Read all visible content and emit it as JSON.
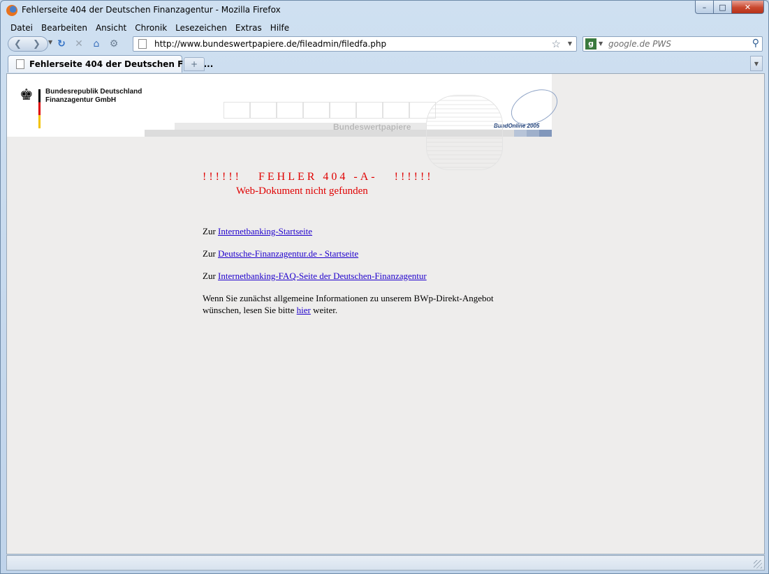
{
  "window": {
    "title": "Fehlerseite 404 der Deutschen Finanzagentur - Mozilla Firefox",
    "controls": {
      "minimize": "–",
      "maximize": "□",
      "close": "✕"
    }
  },
  "menu": [
    "Datei",
    "Bearbeiten",
    "Ansicht",
    "Chronik",
    "Lesezeichen",
    "Extras",
    "Hilfe"
  ],
  "navigation": {
    "url": "http://www.bundeswertpapiere.de/fileadmin/filedfa.php",
    "search_placeholder": "google.de PWS",
    "icons": [
      "back-icon",
      "forward-icon",
      "reload-icon",
      "stop-icon",
      "home-icon",
      "addon-icon",
      "star-icon",
      "search-icon"
    ]
  },
  "tabs": [
    {
      "title": "Fehlerseite 404 der Deutschen Finan...",
      "active": true
    }
  ],
  "page": {
    "org_line1": "Bundesrepublik Deutschland",
    "org_line2": "Finanzagentur GmbH",
    "banner_watermark": "Bundeswertpapiere",
    "bundonline": "BundOnline 2005",
    "error_title": "!!!!!!   FEHLER 404 -A-   !!!!!!",
    "error_subtitle": "Web-Dokument nicht gefunden",
    "prefix": "Zur",
    "links": [
      "Internetbanking-Startseite",
      "Deutsche-Finanzagentur.de - Startseite",
      "Internetbanking-FAQ-Seite der Deutschen-Finanzagentur"
    ],
    "info_line1": "Wenn Sie zunächst allgemeine Informationen zu unserem BWp-Direkt-Angebot",
    "info_line2_before": "wünschen, lesen Sie bitte",
    "info_link": "hier",
    "info_line2_after": "weiter."
  },
  "colors": {
    "error_red": "#e00000",
    "link_blue": "#1f00cc",
    "page_background": "#eeedec",
    "flag_black": "#000000",
    "flag_red": "#dd0000",
    "flag_gold": "#f3c200",
    "bundonline_blue": "#1e3f78"
  }
}
